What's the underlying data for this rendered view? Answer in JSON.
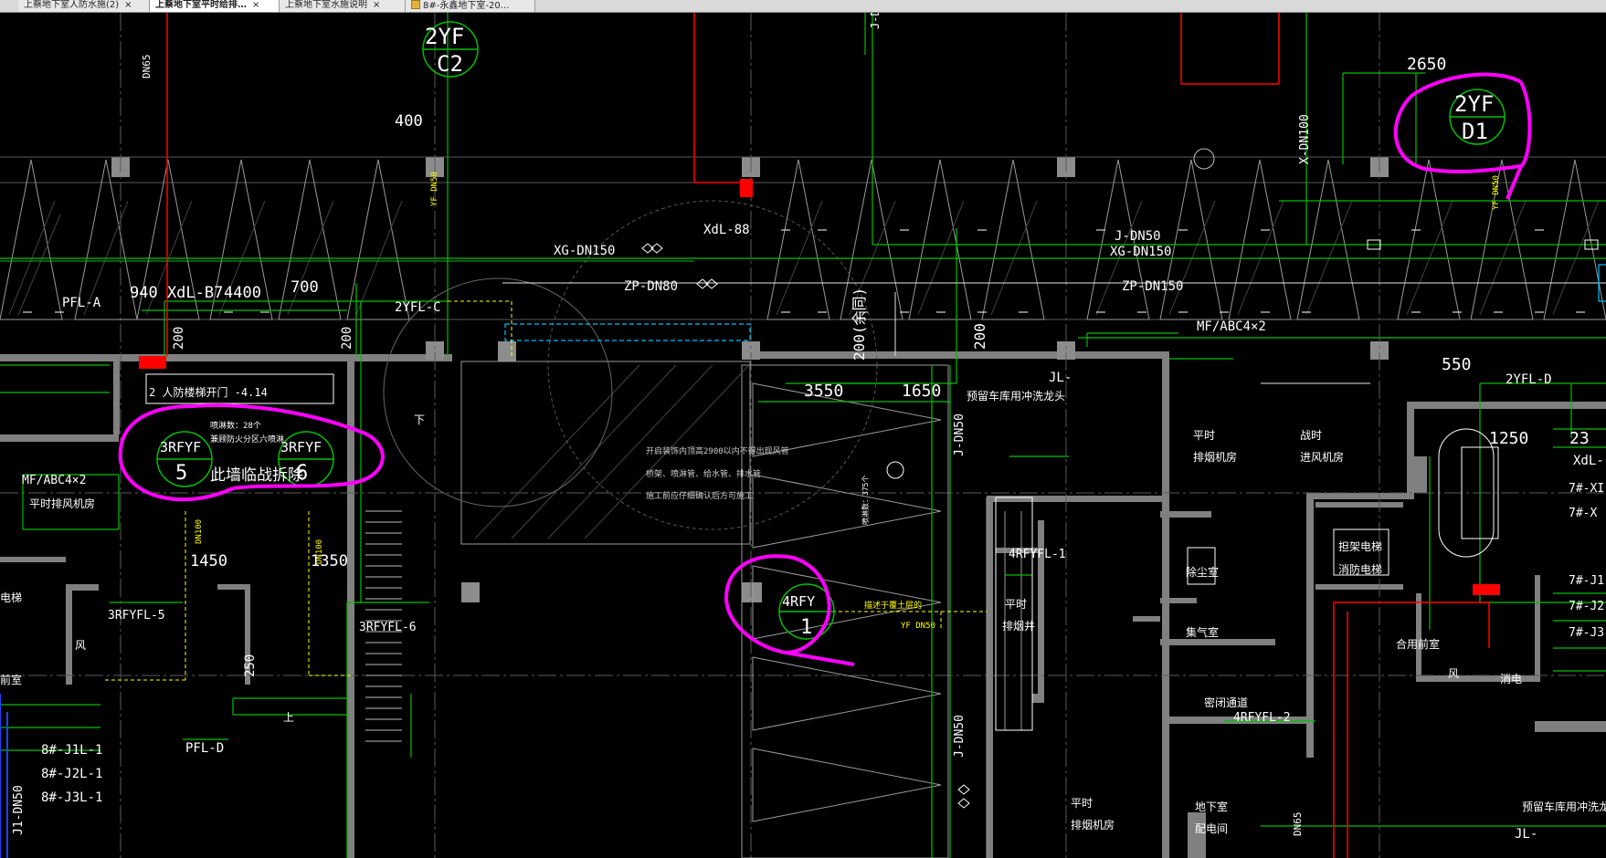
{
  "tabs": [
    {
      "label": "上蔡地下室人防水施(2)",
      "close": "×"
    },
    {
      "label": "上蔡地下室平时给排…",
      "close": "×"
    },
    {
      "label": "上蔡地下室水施说明",
      "close": "×"
    },
    {
      "label": "8#-永鑫地下室-20…",
      "close": ""
    }
  ],
  "colors": {
    "background": "#000000",
    "wall": "#808080",
    "pipe_green": "#00c000",
    "text_white": "#ffffff",
    "text_yellow": "#ffff00",
    "markup_magenta": "#ff00ff",
    "pipe_red": "#ff0000",
    "pipe_cyan": "#00c0ff"
  },
  "annotations": {
    "dn65_top": "DN65",
    "yf_c2_top": "2YF",
    "yf_c2_bottom": "C2",
    "dim_400": "400",
    "yf_dn50_a": "YF DN50",
    "xdl88": "XdL-88",
    "xg_dn150_a": "XG-DN150",
    "zp_dn80": "ZP-DN80",
    "pfl_a": "PFL-A",
    "xdl_b7": "940 XdL-B7",
    "dim_4400": "4400",
    "dim_700": "700",
    "yfl_c": "2YFL-C",
    "dim_200_a": "200",
    "dim_200_b": "200",
    "dim_200_c": "200(余同)",
    "dim_200_d": "200",
    "j_dn50_top": "J-DN50",
    "xg_dn150_b": "XG-DN150",
    "zp_dn150": "ZP-DN150",
    "x_dn100": "X-DN100",
    "dim_2650": "2650",
    "yf_d1_top": "2YF",
    "yf_d1_bottom": "D1",
    "yf_dn50_b": "YF DN50",
    "mf_abc_a": "MF/ABC4×2",
    "dim_550": "550",
    "yfl_d": "2YFL-D",
    "dim_1250": "1250",
    "dim_23": "23",
    "xdl_r": "XdL-",
    "dim_3550": "3550",
    "dim_1650": "1650",
    "jl_a": "JL-",
    "reserve_a": "预留车库用冲洗龙头",
    "j_dn50_mid": "J-DN50",
    "note_line1": "开启装饰内顶高2900以内不得出现风管",
    "note_line2": "桥架、喷淋管、给水管、排水管",
    "note_line3": "施工前应仔细确认后方可施工",
    "rf_sprinkler": "喷淋数：375个",
    "rfyf5_top": "3RFYF",
    "rfyf5_bottom": "5",
    "rfyf6_top": "3RFYF",
    "rfyf6_bottom": "6",
    "wall_remove": "此墙临战拆除",
    "sprinkler_28": "喷淋数：28个",
    "sprinkler_note": "兼顾防火分区六喷淋",
    "rf_label_14": "2 人防楼梯开门 -4.14",
    "mf_abc_b": "MF/ABC4×2",
    "fan_room_left": "平时排风机房",
    "dn100_a": "DN100",
    "dn100_b": "DN100",
    "dim_1450": "1450",
    "dim_1350": "1350",
    "rfyfl5": "3RFYFL-5",
    "rfyfl6": "3RFYFL-6",
    "dim_250": "250",
    "elevator_left": "电梯",
    "wind_left": "风",
    "front_room_left": "前室",
    "pfl_d": "PFL-D",
    "shang": "上",
    "xia": "下",
    "j1l": "8#-J1L-1",
    "j2l": "8#-J2L-1",
    "j3l": "8#-J3L-1",
    "j1_dn50": "J1-DN50",
    "rfy1_top": "4RFY",
    "rfy1_bottom": "1",
    "ceiling_note": "描述于覆土层的",
    "yf_dn50_c": "YF DN50",
    "j_dn50_bot": "J-DN50",
    "peacetime_1": "平时",
    "exhaust_room": "排烟机房",
    "wartime_1": "战时",
    "intake_room": "进风机房",
    "rfyfl1": "4RFYFL-1",
    "peacetime_2": "平时",
    "exhaust_shaft": "排烟井",
    "dust_room": "除尘室",
    "gas_room": "集气室",
    "passage": "密闭通道",
    "rfyfl2": "4RFYFL-2",
    "elevator_r1": "担架电梯",
    "elevator_r2": "消防电梯",
    "shared_front": "合用前室",
    "wind_right": "风",
    "elevator_right": "消电",
    "peacetime_3": "平时",
    "exhaust_room_b": "排烟机房",
    "basement": "地下室",
    "dist_room": "配电间",
    "dn65_bottom": "DN65",
    "reserve_b": "预留车库用冲洗龙头",
    "jl_b": "JL-",
    "r7_1": "7#-XI",
    "r7_2": "7#-X",
    "r7_3": "7#-J1",
    "r7_4": "7#-J2",
    "r7_5": "7#-J3",
    "j_dn_topcenter": "J-D"
  }
}
